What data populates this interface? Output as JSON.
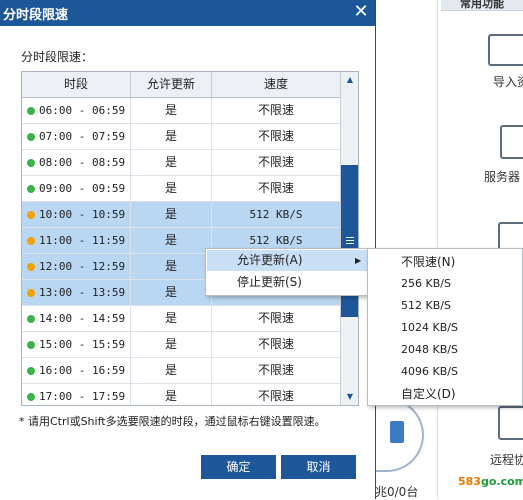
{
  "dialog": {
    "title": "分时段限速",
    "close_glyph": "✕",
    "subtitle": "分时段限速：",
    "hint": "* 请用Ctrl或Shift多选要限速的时段，通过鼠标右键设置限速。",
    "ok_label": "确定",
    "cancel_label": "取消"
  },
  "table": {
    "headers": [
      "时段",
      "允许更新",
      "速度"
    ],
    "rows": [
      {
        "time": "06:00 - 06:59",
        "allow": "是",
        "speed": "不限速",
        "status": "green",
        "selected": false
      },
      {
        "time": "07:00 - 07:59",
        "allow": "是",
        "speed": "不限速",
        "status": "green",
        "selected": false
      },
      {
        "time": "08:00 - 08:59",
        "allow": "是",
        "speed": "不限速",
        "status": "green",
        "selected": false
      },
      {
        "time": "09:00 - 09:59",
        "allow": "是",
        "speed": "不限速",
        "status": "green",
        "selected": false
      },
      {
        "time": "10:00 - 10:59",
        "allow": "是",
        "speed": "512 KB/S",
        "status": "orange",
        "selected": true
      },
      {
        "time": "11:00 - 11:59",
        "allow": "是",
        "speed": "512 KB/S",
        "status": "orange",
        "selected": true
      },
      {
        "time": "12:00 - 12:59",
        "allow": "是",
        "speed": "",
        "status": "orange",
        "selected": true
      },
      {
        "time": "13:00 - 13:59",
        "allow": "是",
        "speed": "",
        "status": "orange",
        "selected": true
      },
      {
        "time": "14:00 - 14:59",
        "allow": "是",
        "speed": "不限速",
        "status": "green",
        "selected": false
      },
      {
        "time": "15:00 - 15:59",
        "allow": "是",
        "speed": "不限速",
        "status": "green",
        "selected": false
      },
      {
        "time": "16:00 - 16:59",
        "allow": "是",
        "speed": "不限速",
        "status": "green",
        "selected": false
      },
      {
        "time": "17:00 - 17:59",
        "allow": "是",
        "speed": "不限速",
        "status": "green",
        "selected": false
      }
    ]
  },
  "context_menu": {
    "items": [
      {
        "label": "允许更新(A)"
      },
      {
        "label": "停止更新(S)"
      }
    ],
    "submenu_arrow": "▶"
  },
  "speed_submenu": {
    "items": [
      {
        "label": "不限速(N)"
      },
      {
        "label": "256 KB/S"
      },
      {
        "label": "512 KB/S"
      },
      {
        "label": "1024 KB/S"
      },
      {
        "label": "2048 KB/S"
      },
      {
        "label": "4096 KB/S"
      },
      {
        "label": "自定义(D)"
      }
    ]
  },
  "background_app": {
    "section_title": "常用功能",
    "items": [
      {
        "label": "导入资"
      },
      {
        "label": "服务器"
      },
      {
        "label": "远程协"
      }
    ],
    "disk_label": "兆0/0台"
  },
  "watermark": {
    "prefix": "583",
    "suffix": "go.com"
  },
  "colors": {
    "primary": "#1e5799",
    "selected_row": "#b9d7f2",
    "status_green": "#3cb34a",
    "status_orange": "#f5a100"
  }
}
